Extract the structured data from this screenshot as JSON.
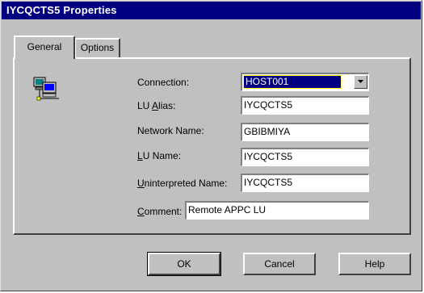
{
  "window": {
    "title": "IYCQCTS5 Properties"
  },
  "tabs": [
    {
      "label": "General",
      "active": true
    },
    {
      "label": "Options",
      "active": false
    }
  ],
  "form": {
    "connection": {
      "label_prefix": "",
      "label_underlined": "",
      "label": "Connection:",
      "value": "HOST001"
    },
    "lu_alias": {
      "label_prefix": "LU ",
      "label_underlined": "A",
      "label_suffix": "lias:",
      "value": "IYCQCTS5"
    },
    "network_name": {
      "label": "Network Name:",
      "value": "GBIBMIYA"
    },
    "lu_name": {
      "label_underlined": "L",
      "label_suffix": "U Name:",
      "value": "IYCQCTS5"
    },
    "uninterpreted_name": {
      "label_underlined": "U",
      "label_suffix": "ninterpreted Name:",
      "value": "IYCQCTS5"
    },
    "comment": {
      "label_underlined": "C",
      "label_suffix": "omment:",
      "value": "Remote APPC LU"
    }
  },
  "buttons": {
    "ok": "OK",
    "cancel": "Cancel",
    "help": "Help"
  },
  "icons": {
    "connection_icon": "network-computers-icon",
    "dropdown_arrow": "chevron-down-icon"
  }
}
